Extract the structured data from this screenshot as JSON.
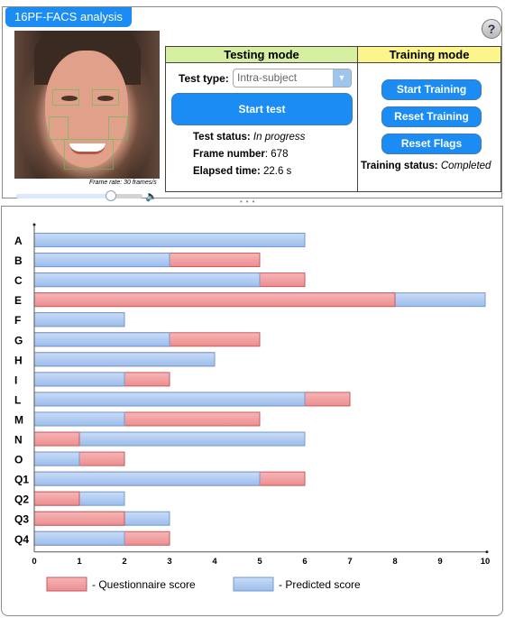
{
  "app": {
    "title": "16PF-FACS analysis",
    "help_label": "?"
  },
  "video": {
    "frame_rate_text": "Frame rate: 30 frames/s",
    "playback_position": 0.75
  },
  "testing_mode": {
    "header": "Testing mode",
    "test_type_label": "Test type:",
    "test_type_value": "Intra-subject",
    "start_test_label": "Start test",
    "test_status_label": "Test status:",
    "test_status_value": "In progress",
    "frame_number_label": "Frame number",
    "frame_number_value": ": 678",
    "elapsed_time_label": "Elapsed time:",
    "elapsed_time_value": "22.6 s"
  },
  "training_mode": {
    "header": "Training mode",
    "start_training_label": "Start Training",
    "reset_training_label": "Reset Training",
    "reset_flags_label": "Reset Flags",
    "training_status_label": "Training status:",
    "training_status_value": "Completed"
  },
  "colors": {
    "accent_blue": "#1b8cf4",
    "questionnaire": "#f2999b",
    "predicted": "#a9c7f0",
    "testing_header": "#d6ee9f",
    "training_header": "#fbf58b"
  },
  "chart_data": {
    "type": "bar",
    "orientation": "horizontal",
    "overlaid": true,
    "categories": [
      "A",
      "B",
      "C",
      "E",
      "F",
      "G",
      "H",
      "I",
      "L",
      "M",
      "N",
      "O",
      "Q1",
      "Q2",
      "Q3",
      "Q4"
    ],
    "series": [
      {
        "name": "Questionnaire score",
        "legend_label": "- Questionnaire score",
        "color": "#f2999b",
        "values": [
          6,
          5,
          6,
          8,
          2,
          5,
          4,
          3,
          7,
          5,
          1,
          2,
          6,
          1,
          2,
          3
        ]
      },
      {
        "name": "Predicted score",
        "legend_label": "- Predicted score",
        "color": "#a9c7f0",
        "values": [
          6,
          3,
          5,
          10,
          2,
          3,
          4,
          2,
          6,
          2,
          6,
          1,
          5,
          2,
          3,
          2
        ]
      }
    ],
    "x_ticks": [
      "0",
      "1",
      "2",
      "3",
      "4",
      "5",
      "6",
      "7",
      "8",
      "9",
      "10"
    ],
    "xlim": [
      0,
      10
    ],
    "xlabel": "",
    "ylabel": "",
    "grid": false,
    "legend_position": "bottom"
  }
}
